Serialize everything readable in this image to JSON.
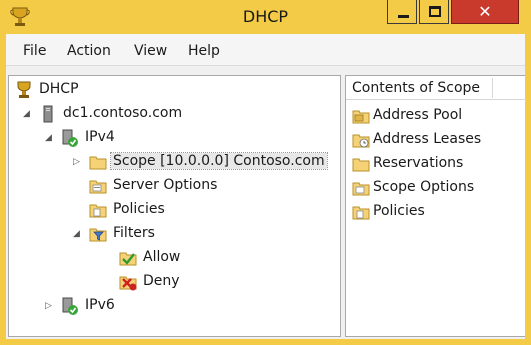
{
  "window": {
    "title": "DHCP"
  },
  "titlebar": {
    "close_glyph": "✕"
  },
  "menu": [
    "File",
    "Action",
    "View",
    "Help"
  ],
  "tree": {
    "root": "DHCP",
    "server": "dc1.contoso.com",
    "ipv4": "IPv4",
    "scope": "Scope [10.0.0.0] Contoso.com",
    "server_options": "Server Options",
    "policies": "Policies",
    "filters": "Filters",
    "allow": "Allow",
    "deny": "Deny",
    "ipv6": "IPv6"
  },
  "contents": {
    "header": "Contents of Scope",
    "items": [
      "Address Pool",
      "Address Leases",
      "Reservations",
      "Scope Options",
      "Policies"
    ]
  },
  "colors": {
    "titlebar": "#f4cb46",
    "close_button": "#c9392c",
    "folder": "#f5d276"
  },
  "icons": {
    "app": "dhcp-trophy-icon",
    "server": "server-tower-icon",
    "ipv4": "network-check-icon",
    "folder": "folder-icon",
    "filter": "filter-funnel-icon",
    "allow": "allow-check-icon",
    "deny": "deny-x-icon"
  }
}
